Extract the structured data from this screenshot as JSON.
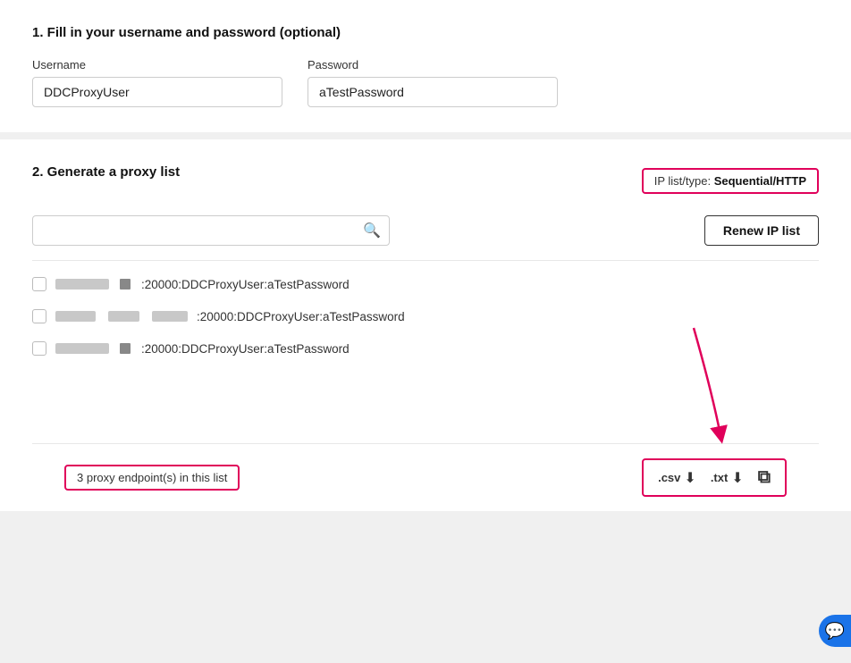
{
  "section1": {
    "title": "1. Fill in your username and password (optional)",
    "username_label": "Username",
    "username_value": "DDCProxyUser",
    "password_label": "Password",
    "password_value": "aTestPassword"
  },
  "section2": {
    "title": "2. Generate a proxy list",
    "ip_list_label": "IP list/type:",
    "ip_list_value": "Sequential/HTTP",
    "search_placeholder": "",
    "renew_btn": "Renew IP list",
    "proxy_rows": [
      {
        "suffix": ":20000:DDCProxyUser:aTestPassword"
      },
      {
        "suffix": ":20000:DDCProxyUser:aTestPassword"
      },
      {
        "suffix": ":20000:DDCProxyUser:aTestPassword"
      }
    ],
    "endpoint_count": "3 proxy endpoint(s) in this list",
    "csv_label": ".csv",
    "txt_label": ".txt",
    "download_icon": "↓",
    "copy_icon": "⧉"
  }
}
